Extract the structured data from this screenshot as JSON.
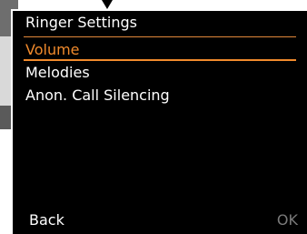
{
  "screen": {
    "title": "Ringer Settings",
    "menu": [
      {
        "label": "Volume",
        "selected": true
      },
      {
        "label": "Melodies",
        "selected": false
      },
      {
        "label": "Anon. Call Silencing",
        "selected": false
      }
    ]
  },
  "softkeys": {
    "left_label": "Back",
    "right_label": "OK"
  },
  "colors": {
    "background": "#000000",
    "text": "#ffffff",
    "accent": "#f08a2c",
    "disabled": "#7a7a7a"
  }
}
